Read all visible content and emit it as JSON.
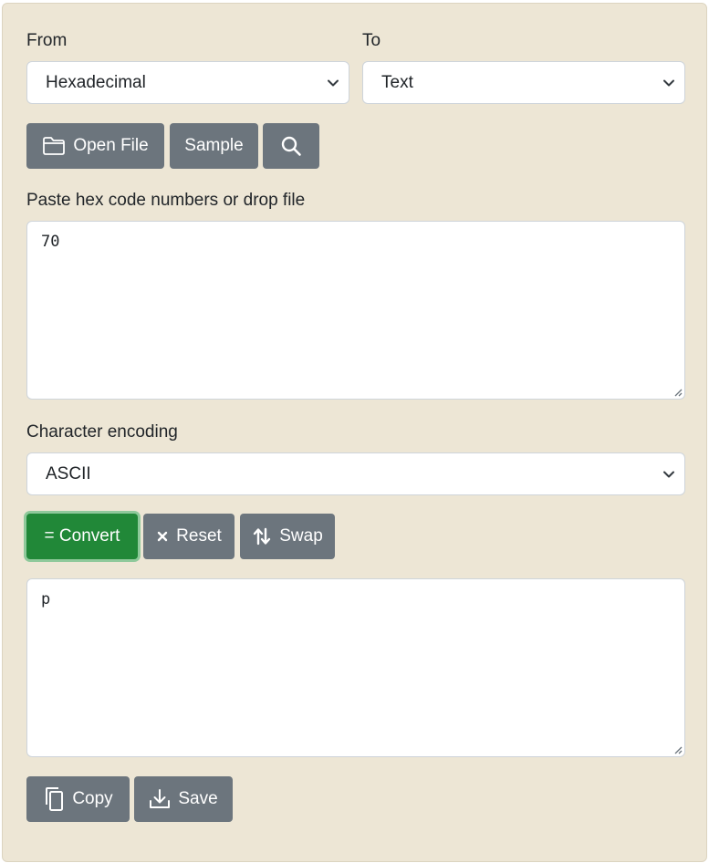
{
  "from": {
    "label": "From",
    "selected": "Hexadecimal"
  },
  "to": {
    "label": "To",
    "selected": "Text"
  },
  "toolbar": {
    "open_file": "Open File",
    "sample": "Sample"
  },
  "input": {
    "label": "Paste hex code numbers or drop file",
    "value": "70"
  },
  "encoding": {
    "label": "Character encoding",
    "selected": "ASCII"
  },
  "actions": {
    "convert": "= Convert",
    "reset": "Reset",
    "swap": "Swap"
  },
  "output": {
    "value": "p"
  },
  "bottom": {
    "copy": "Copy",
    "save": "Save"
  },
  "colors": {
    "panel_bg": "#ede6d5",
    "button_gray": "#6c757d",
    "button_green": "#218838",
    "focus_ring": "#8fc99b"
  },
  "icons": [
    "folder-icon",
    "search-icon",
    "close-icon",
    "swap-icon",
    "copy-icon",
    "download-icon",
    "chevron-down-icon"
  ]
}
